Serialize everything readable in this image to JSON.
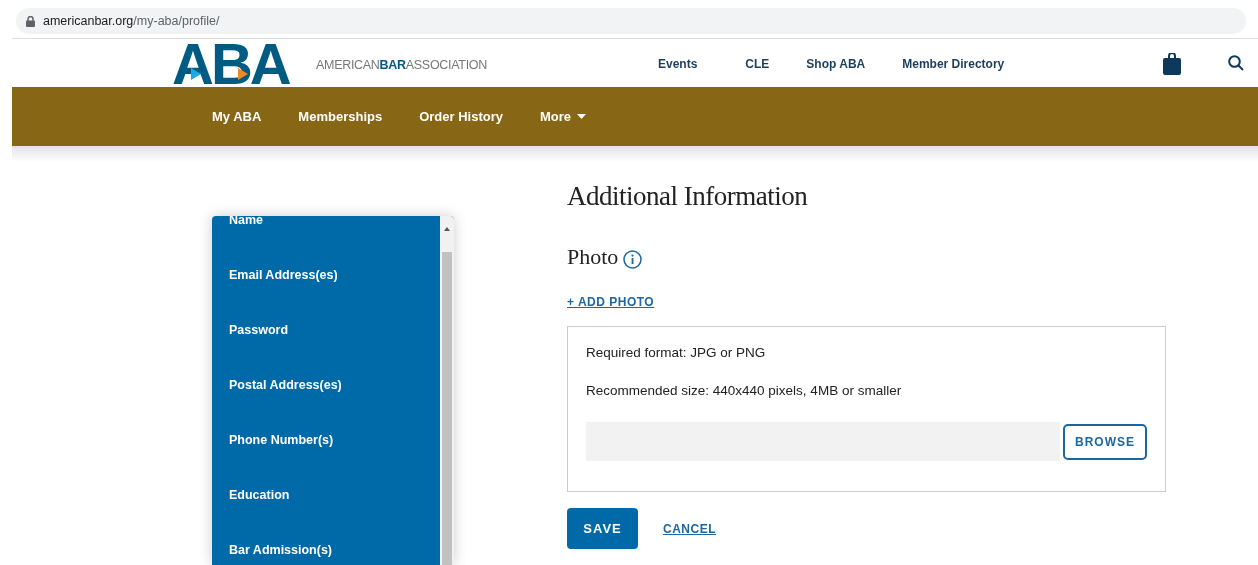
{
  "browser": {
    "url_host": "americanbar.org",
    "url_path": "/my-aba/profile/"
  },
  "header": {
    "logo_mark": "ABA",
    "logo_wordmark": "AMERICAN**BAR**ASSOCIATION",
    "links": [
      "Events",
      "CLE",
      "Shop ABA",
      "Member Directory"
    ]
  },
  "main_nav": [
    {
      "label": "My ABA",
      "kind": "link"
    },
    {
      "label": "Memberships",
      "kind": "link"
    },
    {
      "label": "Order History",
      "kind": "link"
    },
    {
      "label": "More",
      "kind": "dropdown"
    }
  ],
  "sidebar": {
    "items": [
      "Name",
      "Email Address(es)",
      "Password",
      "Postal Address(es)",
      "Phone Number(s)",
      "Education",
      "Bar Admission(s)"
    ]
  },
  "content": {
    "title": "Additional Information",
    "section_title": "Photo",
    "add_link": "+ ADD PHOTO",
    "upload": {
      "format_note": "Required format: JPG or PNG",
      "size_note": "Recommended size: 440x440 pixels, 4MB or smaller",
      "browse_button": "BROWSE"
    },
    "save_button": "SAVE",
    "cancel_link": "CANCEL"
  }
}
